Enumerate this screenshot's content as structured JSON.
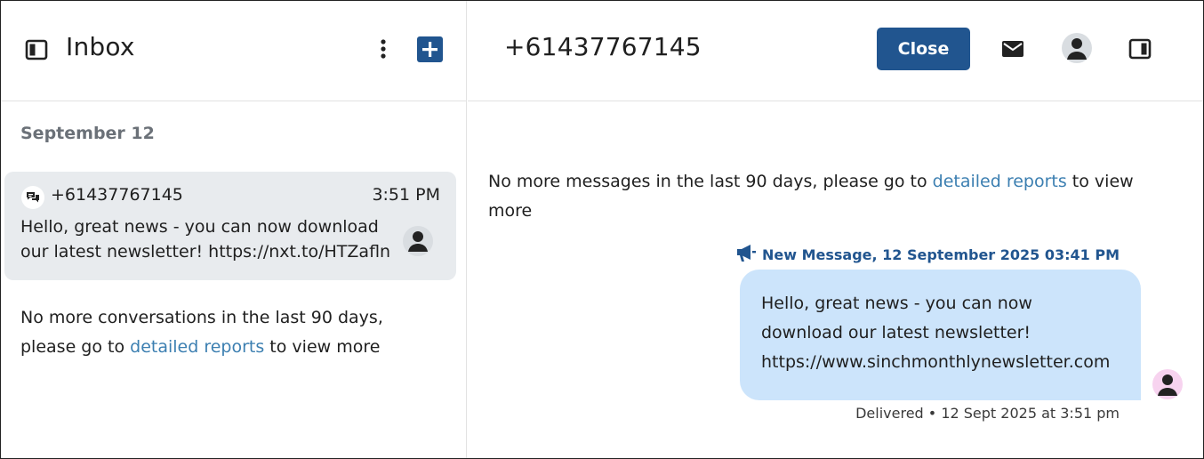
{
  "inbox": {
    "title": "Inbox",
    "date_group": "September 12",
    "conversation": {
      "number": "+61437767145",
      "time": "3:51 PM",
      "preview": "Hello, great news - you can now download our latest newsletter!  https://nxt.to/HTZafln"
    },
    "no_more_prefix": "No more conversations in the last 90 days, please go to ",
    "no_more_link": "detailed reports",
    "no_more_suffix": " to view more"
  },
  "thread": {
    "title": "+61437767145",
    "close_label": "Close",
    "no_more_prefix": "No more messages in the last 90 days, please go to ",
    "no_more_link": "detailed reports",
    "no_more_suffix": " to view more",
    "message": {
      "meta": "New Message, 12 September 2025 03:41 PM",
      "line1": "Hello, great news - you can now",
      "line2": "download our latest newsletter!",
      "line3": "https://www.sinchmonthlynewsletter.com",
      "status": "Delivered • 12 Sept 2025 at 3:51 pm"
    }
  },
  "icons": {
    "sidebar_toggle": "sidebar-icon",
    "more": "kebab-icon",
    "compose": "plus-square-icon",
    "email": "envelope-icon",
    "contact": "avatar-icon",
    "details_panel": "panel-right-icon",
    "channel": "chat-bubbles-icon",
    "campaign": "megaphone-icon"
  },
  "colors": {
    "primary": "#21558f",
    "link": "#3c7fb1",
    "bubble": "#cce4fb",
    "selected_row": "#e8ebee",
    "muted_text": "#6b7178"
  }
}
